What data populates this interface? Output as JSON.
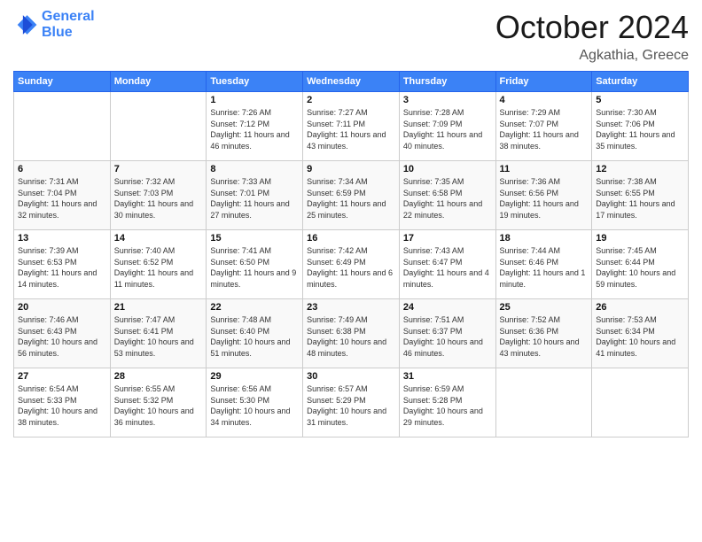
{
  "logo": {
    "line1": "General",
    "line2": "Blue"
  },
  "title": "October 2024",
  "location": "Agkathia, Greece",
  "header_days": [
    "Sunday",
    "Monday",
    "Tuesday",
    "Wednesday",
    "Thursday",
    "Friday",
    "Saturday"
  ],
  "weeks": [
    [
      {
        "day": "",
        "content": ""
      },
      {
        "day": "",
        "content": ""
      },
      {
        "day": "1",
        "content": "Sunrise: 7:26 AM\nSunset: 7:12 PM\nDaylight: 11 hours and 46 minutes."
      },
      {
        "day": "2",
        "content": "Sunrise: 7:27 AM\nSunset: 7:11 PM\nDaylight: 11 hours and 43 minutes."
      },
      {
        "day": "3",
        "content": "Sunrise: 7:28 AM\nSunset: 7:09 PM\nDaylight: 11 hours and 40 minutes."
      },
      {
        "day": "4",
        "content": "Sunrise: 7:29 AM\nSunset: 7:07 PM\nDaylight: 11 hours and 38 minutes."
      },
      {
        "day": "5",
        "content": "Sunrise: 7:30 AM\nSunset: 7:06 PM\nDaylight: 11 hours and 35 minutes."
      }
    ],
    [
      {
        "day": "6",
        "content": "Sunrise: 7:31 AM\nSunset: 7:04 PM\nDaylight: 11 hours and 32 minutes."
      },
      {
        "day": "7",
        "content": "Sunrise: 7:32 AM\nSunset: 7:03 PM\nDaylight: 11 hours and 30 minutes."
      },
      {
        "day": "8",
        "content": "Sunrise: 7:33 AM\nSunset: 7:01 PM\nDaylight: 11 hours and 27 minutes."
      },
      {
        "day": "9",
        "content": "Sunrise: 7:34 AM\nSunset: 6:59 PM\nDaylight: 11 hours and 25 minutes."
      },
      {
        "day": "10",
        "content": "Sunrise: 7:35 AM\nSunset: 6:58 PM\nDaylight: 11 hours and 22 minutes."
      },
      {
        "day": "11",
        "content": "Sunrise: 7:36 AM\nSunset: 6:56 PM\nDaylight: 11 hours and 19 minutes."
      },
      {
        "day": "12",
        "content": "Sunrise: 7:38 AM\nSunset: 6:55 PM\nDaylight: 11 hours and 17 minutes."
      }
    ],
    [
      {
        "day": "13",
        "content": "Sunrise: 7:39 AM\nSunset: 6:53 PM\nDaylight: 11 hours and 14 minutes."
      },
      {
        "day": "14",
        "content": "Sunrise: 7:40 AM\nSunset: 6:52 PM\nDaylight: 11 hours and 11 minutes."
      },
      {
        "day": "15",
        "content": "Sunrise: 7:41 AM\nSunset: 6:50 PM\nDaylight: 11 hours and 9 minutes."
      },
      {
        "day": "16",
        "content": "Sunrise: 7:42 AM\nSunset: 6:49 PM\nDaylight: 11 hours and 6 minutes."
      },
      {
        "day": "17",
        "content": "Sunrise: 7:43 AM\nSunset: 6:47 PM\nDaylight: 11 hours and 4 minutes."
      },
      {
        "day": "18",
        "content": "Sunrise: 7:44 AM\nSunset: 6:46 PM\nDaylight: 11 hours and 1 minute."
      },
      {
        "day": "19",
        "content": "Sunrise: 7:45 AM\nSunset: 6:44 PM\nDaylight: 10 hours and 59 minutes."
      }
    ],
    [
      {
        "day": "20",
        "content": "Sunrise: 7:46 AM\nSunset: 6:43 PM\nDaylight: 10 hours and 56 minutes."
      },
      {
        "day": "21",
        "content": "Sunrise: 7:47 AM\nSunset: 6:41 PM\nDaylight: 10 hours and 53 minutes."
      },
      {
        "day": "22",
        "content": "Sunrise: 7:48 AM\nSunset: 6:40 PM\nDaylight: 10 hours and 51 minutes."
      },
      {
        "day": "23",
        "content": "Sunrise: 7:49 AM\nSunset: 6:38 PM\nDaylight: 10 hours and 48 minutes."
      },
      {
        "day": "24",
        "content": "Sunrise: 7:51 AM\nSunset: 6:37 PM\nDaylight: 10 hours and 46 minutes."
      },
      {
        "day": "25",
        "content": "Sunrise: 7:52 AM\nSunset: 6:36 PM\nDaylight: 10 hours and 43 minutes."
      },
      {
        "day": "26",
        "content": "Sunrise: 7:53 AM\nSunset: 6:34 PM\nDaylight: 10 hours and 41 minutes."
      }
    ],
    [
      {
        "day": "27",
        "content": "Sunrise: 6:54 AM\nSunset: 5:33 PM\nDaylight: 10 hours and 38 minutes."
      },
      {
        "day": "28",
        "content": "Sunrise: 6:55 AM\nSunset: 5:32 PM\nDaylight: 10 hours and 36 minutes."
      },
      {
        "day": "29",
        "content": "Sunrise: 6:56 AM\nSunset: 5:30 PM\nDaylight: 10 hours and 34 minutes."
      },
      {
        "day": "30",
        "content": "Sunrise: 6:57 AM\nSunset: 5:29 PM\nDaylight: 10 hours and 31 minutes."
      },
      {
        "day": "31",
        "content": "Sunrise: 6:59 AM\nSunset: 5:28 PM\nDaylight: 10 hours and 29 minutes."
      },
      {
        "day": "",
        "content": ""
      },
      {
        "day": "",
        "content": ""
      }
    ]
  ]
}
